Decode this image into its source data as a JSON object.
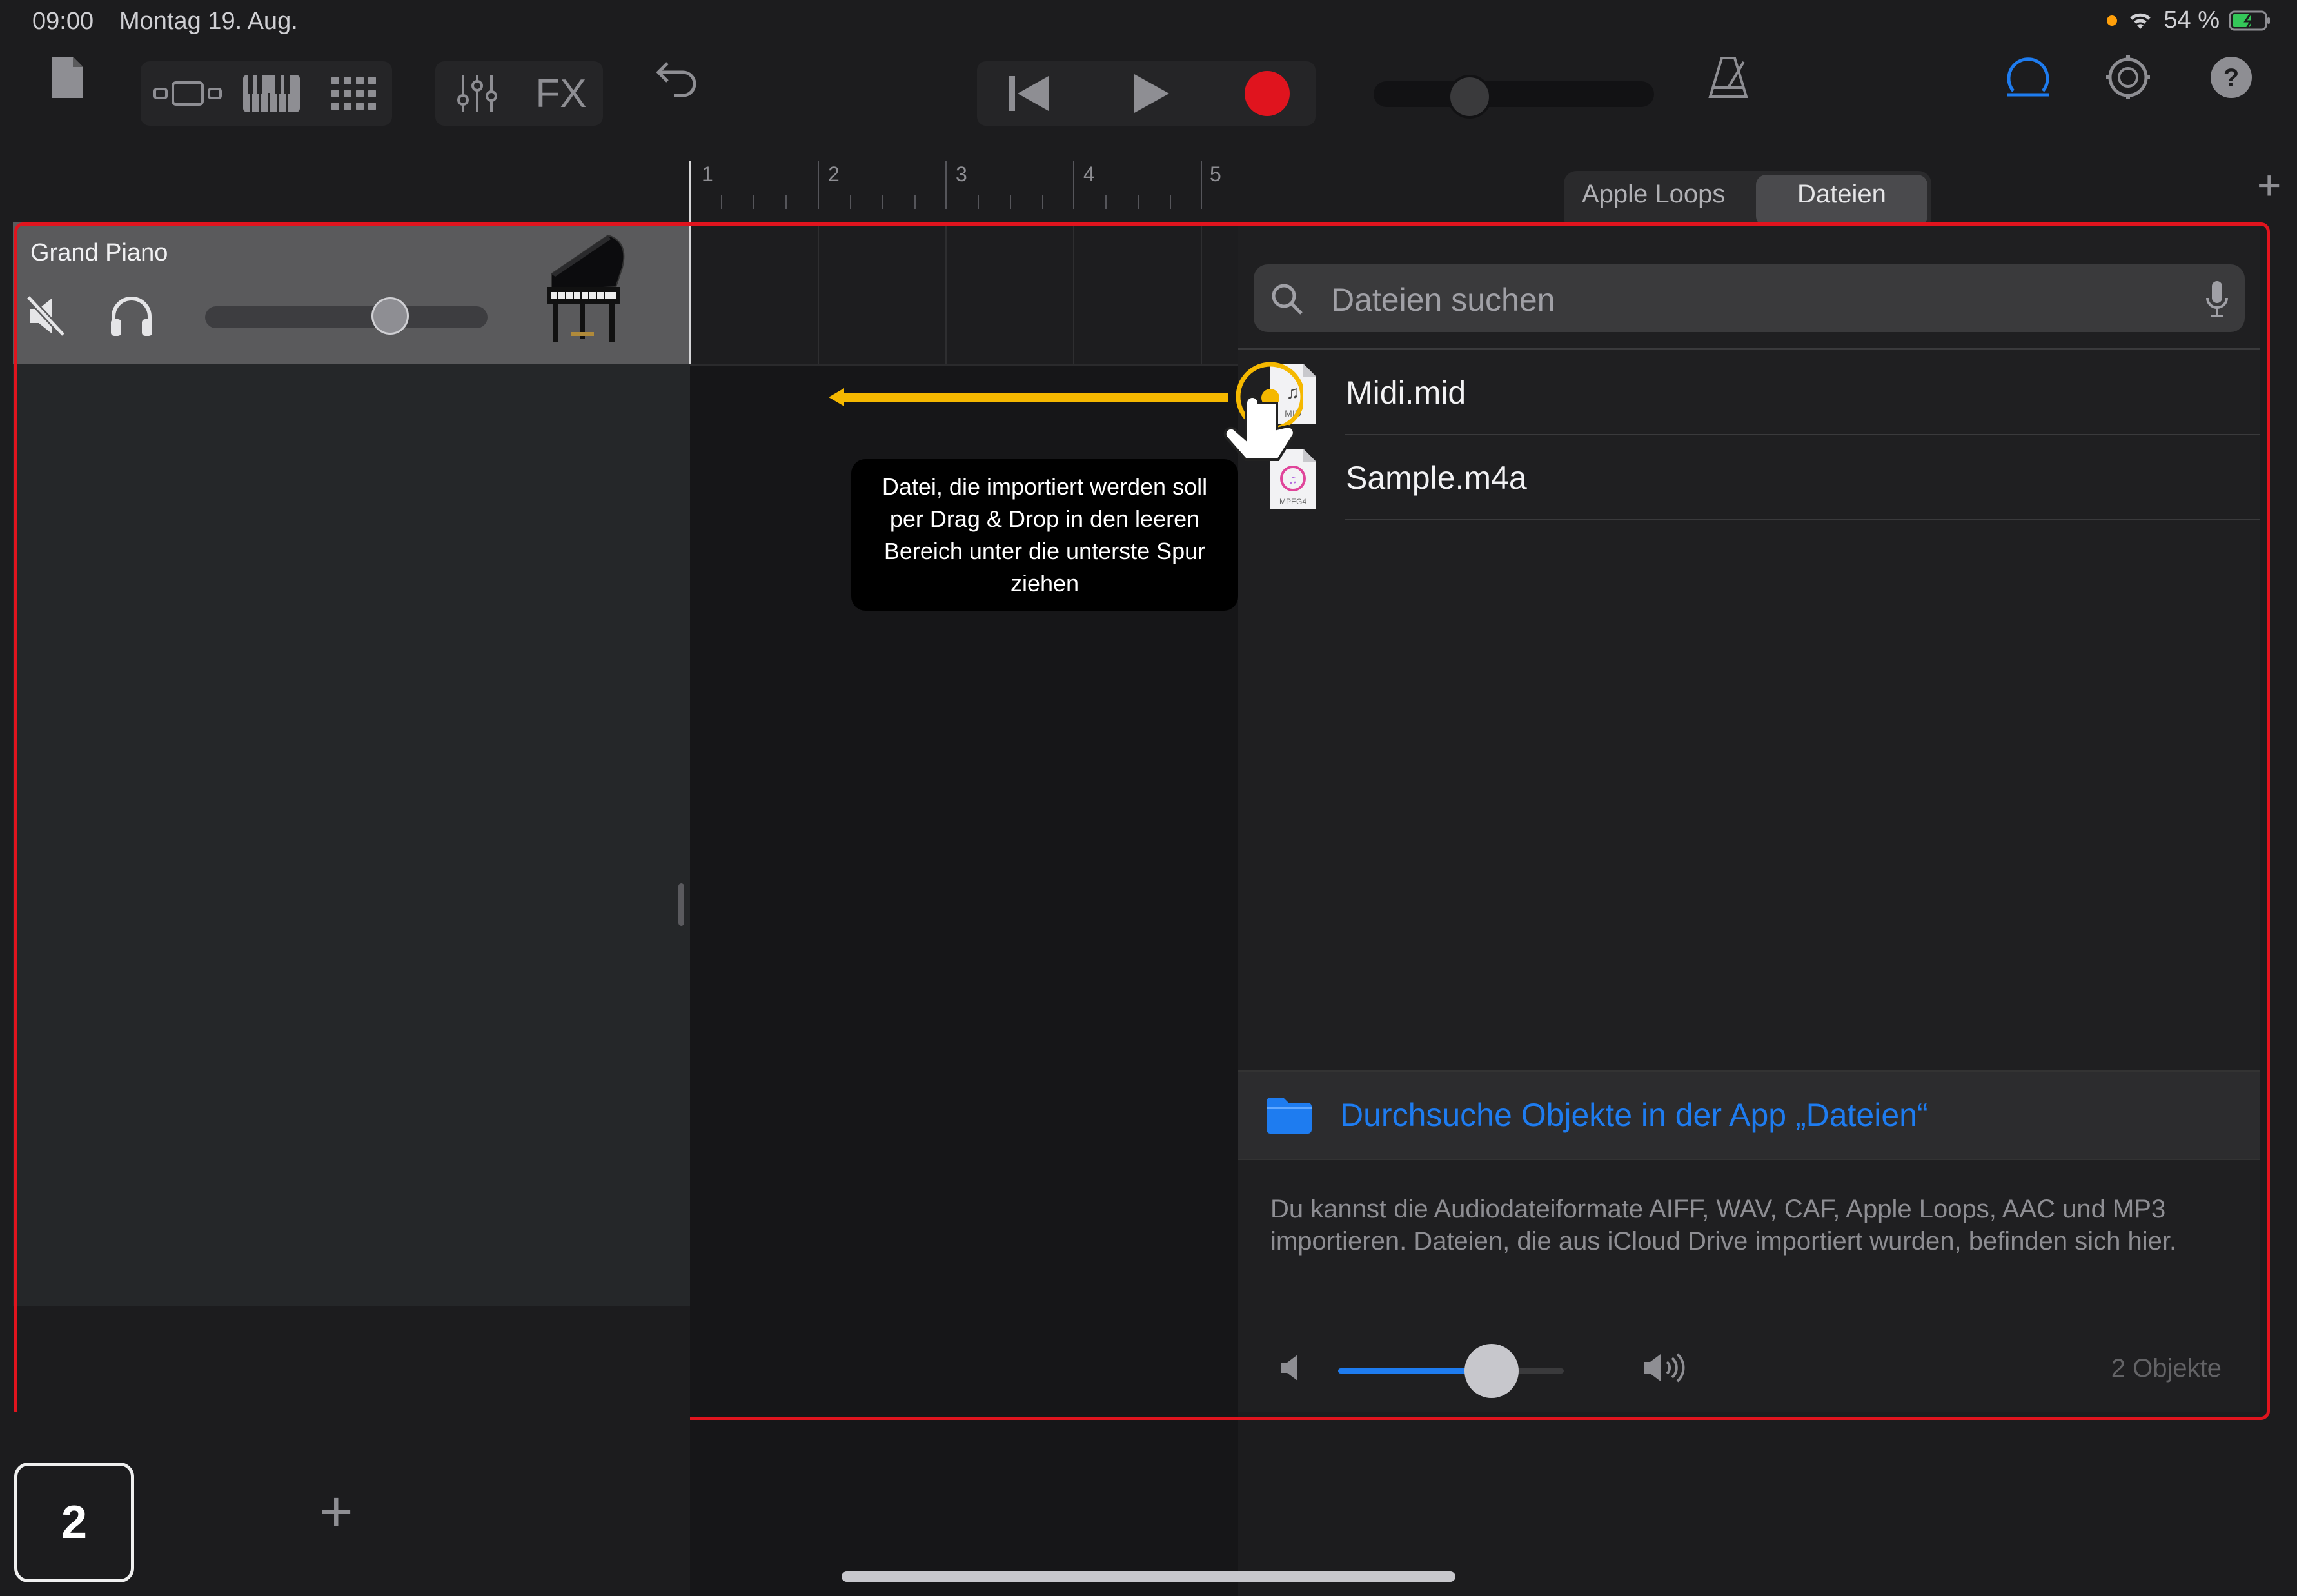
{
  "status_bar": {
    "time": "09:00",
    "date": "Montag 19. Aug.",
    "battery": "54 %"
  },
  "toolbar": {
    "icons": [
      "document-icon",
      "track-view-icon",
      "keyboard-icon",
      "grid-icon",
      "mixer-icon",
      "fx-icon",
      "undo-icon",
      "rewind-icon",
      "play-icon",
      "record-icon",
      "master-volume",
      "metronome-icon",
      "loop-browser-icon",
      "settings-icon",
      "help-icon"
    ],
    "fx_label": "FX",
    "record_color": "#e0141e",
    "accent_color": "#1e7cf0"
  },
  "ruler": {
    "bars": [
      "1",
      "2",
      "3",
      "4",
      "5"
    ]
  },
  "browser_tabs": {
    "apple_loops": "Apple Loops",
    "files": "Dateien",
    "selected": "Dateien"
  },
  "track": {
    "name": "Grand Piano",
    "volume": 0.68
  },
  "search": {
    "placeholder": "Dateien suchen"
  },
  "files": [
    {
      "name": "Midi.mid",
      "badge": "MID"
    },
    {
      "name": "Sample.m4a",
      "badge": "MPEG4"
    }
  ],
  "browse_link": "Durchsuche Objekte in der App „Dateien“",
  "info_text": "Du kannst die Audiodateiformate AIFF, WAV, CAF, Apple Loops, AAC und MP3 importieren. Dateien, die aus iCloud Drive importiert wurden, befinden sich hier.",
  "preview_volume": 0.68,
  "count": "2 Objekte",
  "callout": "Datei, die importiert werden soll per Drag & Drop in den leeren Bereich unter die unterste Spur ziehen",
  "step_number": "2",
  "annotation_colors": {
    "highlight": "#e0141e",
    "arrow": "#f5b800"
  }
}
